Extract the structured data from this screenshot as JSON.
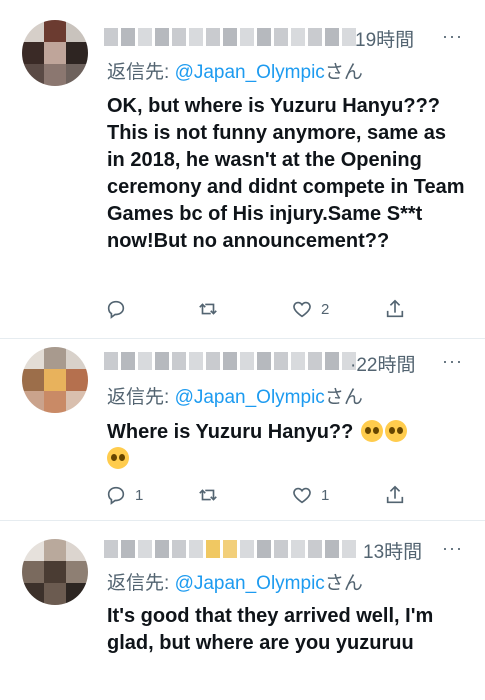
{
  "tweets": [
    {
      "time": "19時間",
      "more": "···",
      "reply_prefix": "返信先: ",
      "reply_handle": "@Japan_Olympic",
      "reply_suffix": "さん",
      "body": "OK, but where is Yuzuru Hanyu???This is not funny anymore, same as in 2018, he wasn't at the Opening ceremony and didnt compete in Team Games bc of His injury.Same S**t now!But no announcement??",
      "reply_count": "",
      "retweet_count": "",
      "like_count": "2"
    },
    {
      "time": "·22時間",
      "more": "···",
      "reply_prefix": "返信先: ",
      "reply_handle": "@Japan_Olympic",
      "reply_suffix": "さん",
      "body": "Where is Yuzuru Hanyu??",
      "emoji": "pleading-face",
      "reply_count": "1",
      "retweet_count": "",
      "like_count": "1"
    },
    {
      "time": "13時間",
      "more": "···",
      "reply_prefix": "返信先: ",
      "reply_handle": "@Japan_Olympic",
      "reply_suffix": "さん",
      "body": "It's good that they arrived well, I'm glad, but where are you yuzuruu"
    }
  ],
  "colors": {
    "accent": "#1d9bf0",
    "secondary_text": "#536471",
    "divider": "#e6ecf0"
  },
  "icons": [
    "reply-icon",
    "retweet-icon",
    "like-icon",
    "share-icon",
    "more-icon"
  ]
}
